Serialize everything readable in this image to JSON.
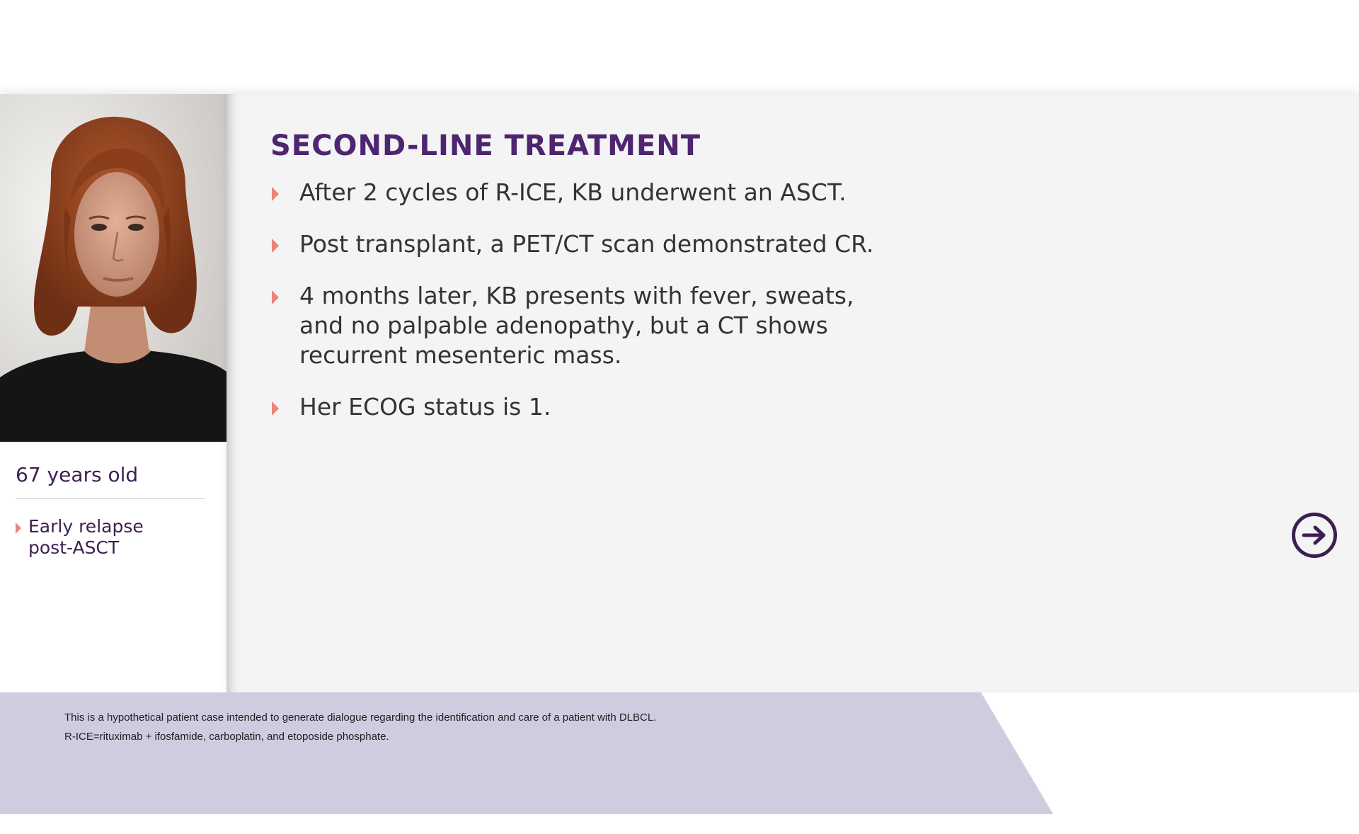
{
  "patient": {
    "portrait_alt": "Patient portrait",
    "age": "67 years old",
    "conditions": [
      {
        "label": "Early relapse post-ASCT"
      }
    ]
  },
  "main": {
    "title": "SECOND-LINE TREATMENT",
    "bullets": [
      {
        "text": "After 2 cycles of R-ICE, KB underwent an ASCT."
      },
      {
        "text": "Post transplant, a PET/CT scan demonstrated CR."
      },
      {
        "text": "4 months later, KB presents with fever, sweats, and no palpable adenopathy, but a CT shows recurrent mesenteric mass."
      },
      {
        "text": "Her ECOG status is 1."
      }
    ],
    "next_button_icon": "arrow-right-circle-icon"
  },
  "footer": {
    "note_1": "This is a hypothetical patient case intended to generate dialogue regarding the identification and care of a patient with DLBCL.",
    "note_2": "R-ICE=rituximab + ifosfamide, carboplatin, and etoposide phosphate."
  },
  "colors": {
    "title": "#4e2570",
    "accent_arrow": "#e9857a",
    "text_dark_purple": "#3c1f52",
    "body_text": "#333333",
    "main_bg": "#f4f4f4",
    "footer_bg": "#cfccdf"
  }
}
